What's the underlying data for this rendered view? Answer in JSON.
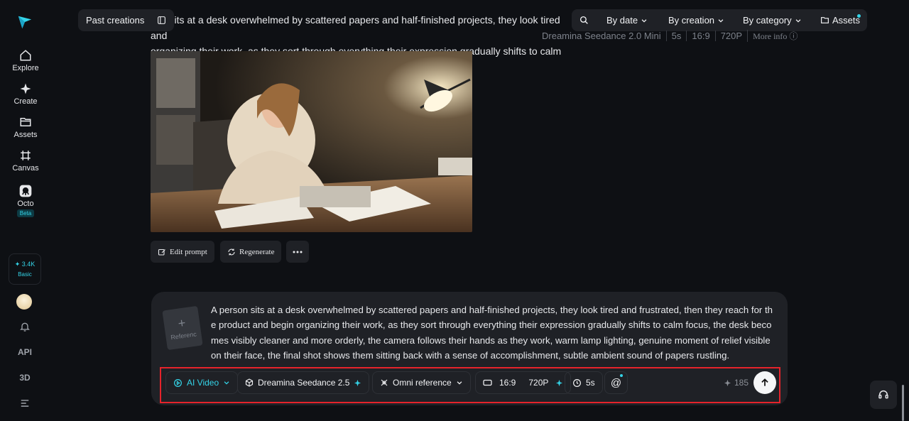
{
  "sidebar": {
    "items": [
      {
        "label": "Explore",
        "icon": "home-icon"
      },
      {
        "label": "Create",
        "icon": "sparkle-icon"
      },
      {
        "label": "Assets",
        "icon": "folder-icon"
      },
      {
        "label": "Canvas",
        "icon": "canvas-icon"
      },
      {
        "label": "Octo",
        "icon": "octo-icon",
        "badge": "Beta"
      }
    ],
    "credits": {
      "value": "3.4K",
      "plan": "Basic"
    },
    "bottom": [
      {
        "icon": "bell-icon"
      },
      {
        "label": "API",
        "icon": "api-icon"
      },
      {
        "label": "3D",
        "icon": "3d-icon"
      },
      {
        "icon": "menu-icon"
      }
    ]
  },
  "topbar": {
    "past_creations": "Past creations",
    "filters": [
      "By date",
      "By creation",
      "By category"
    ],
    "assets": "Assets"
  },
  "entry": {
    "prompt_line1": "son sits at a desk overwhelmed by scattered papers and half-finished projects, they look tired and",
    "prompt_line2": "organizing their work, as they sort through everything their expression gradually shifts to calm",
    "model": "Dreamina Seedance 2.0 Mini",
    "duration": "5s",
    "ratio": "16:9",
    "resolution": "720P",
    "more_info": "More info",
    "actions": {
      "edit": "Edit prompt",
      "regenerate": "Regenerate"
    }
  },
  "composer": {
    "reference_label": "Referenc",
    "prompt": "A person sits at a desk overwhelmed by scattered papers and half-finished projects, they look tired and frustrated, then they reach for the product and begin organizing their work, as they sort through everything their expression gradually shifts to calm focus, the desk becomes visibly cleaner and more orderly, the camera follows their hands as they work, warm lamp lighting, genuine moment of relief visible on their face, the final shot shows them sitting back with a sense of accomplishment, subtle ambient sound of papers rustling.",
    "mode": "AI Video",
    "model": "Dreamina Seedance 2.5",
    "reference_mode": "Omni reference",
    "ratio": "16:9",
    "resolution": "720P",
    "duration": "5s",
    "mention": "@",
    "cost": "185"
  },
  "colors": {
    "accent": "#34d4e8",
    "highlight_outline": "#e5232b",
    "panel": "#1f2126",
    "background": "#0e1014"
  }
}
